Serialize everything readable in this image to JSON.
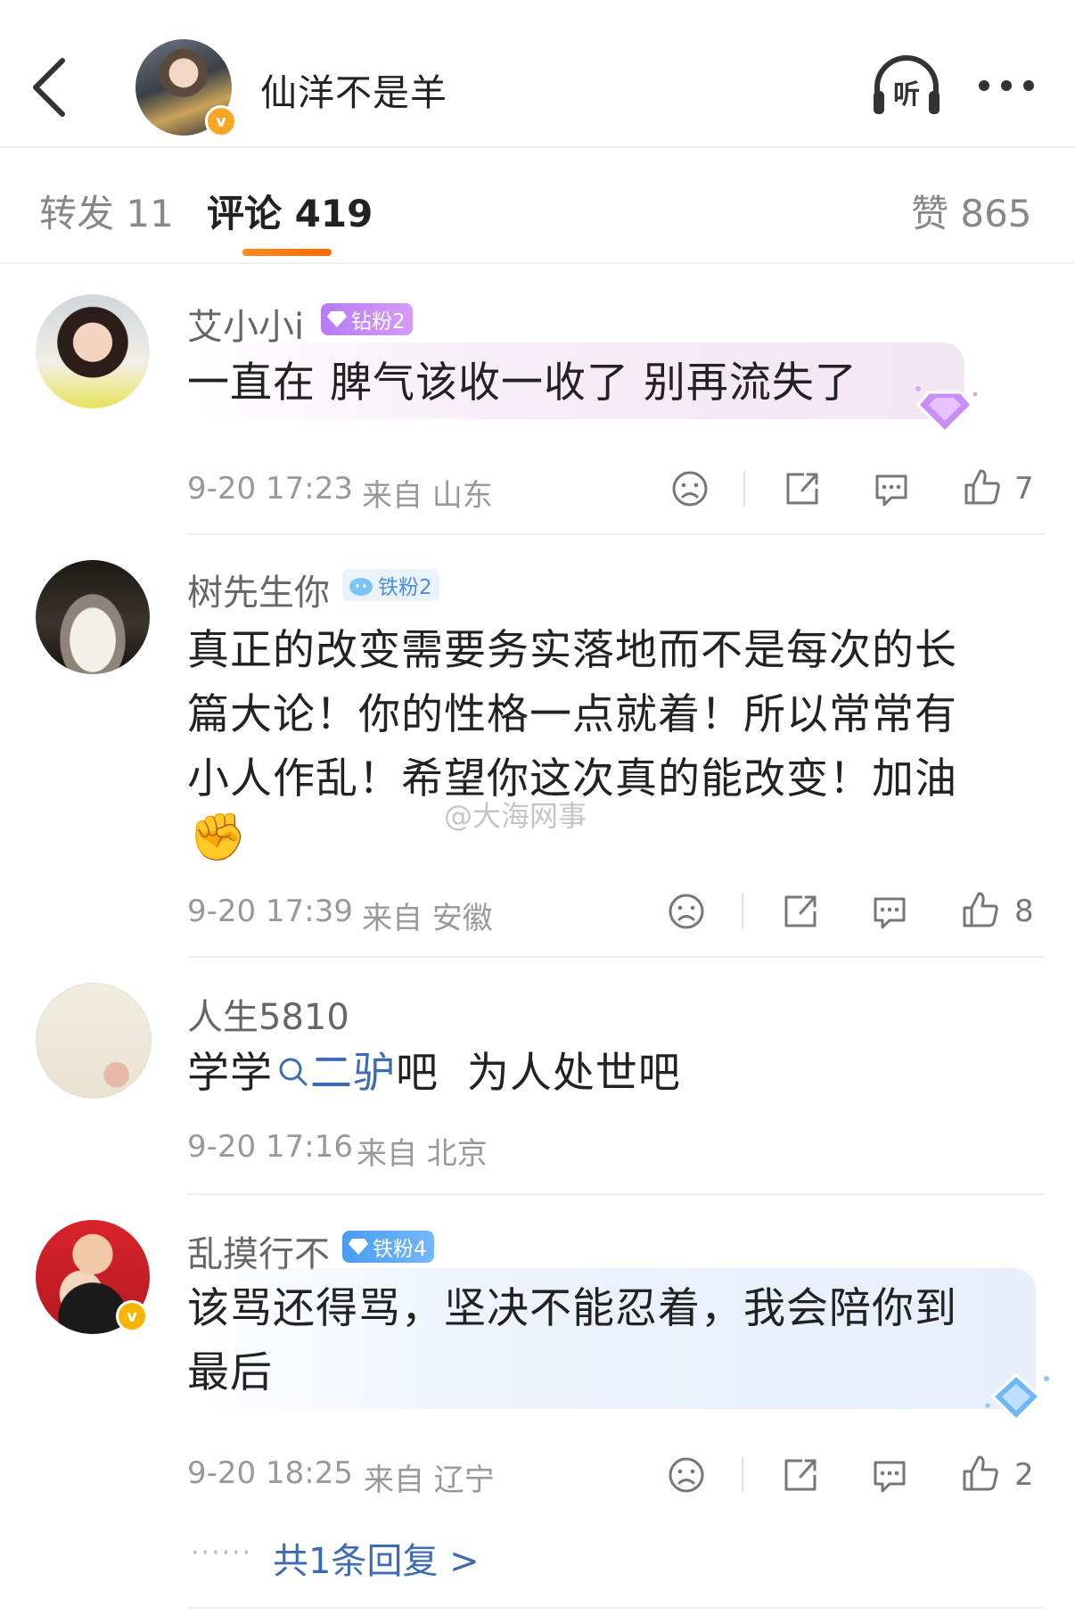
{
  "header": {
    "title": "仙洋不是羊"
  },
  "tabs": [
    {
      "label": "转发 11"
    },
    {
      "label": "评论 419"
    },
    {
      "label": "赞 865"
    }
  ],
  "comments": [
    {
      "user": "艾小小i",
      "badge": "钻粉2",
      "text": "一直在 脾气该收一收了 别再流失了",
      "time": "9-20 17:23",
      "source": "来自 山东",
      "likes": "7"
    },
    {
      "user": "树先生你",
      "badge": "铁粉2",
      "text_lines": [
        "真正的改变需要务实落地而不是每次的长",
        "篇大论！你的性格一点就着！所以常常有",
        "小人作乱！希望你这次真的能改变！加油"
      ],
      "emoji": "✊",
      "time": "9-20 17:39",
      "source": "来自 安徽",
      "likes": "8"
    },
    {
      "user": "人生5810",
      "text_before": "学学",
      "search_keyword": "二驴",
      "text_after": "吧  为人处世吧",
      "time": "9-20 17:16",
      "source": "来自 北京"
    },
    {
      "user": "乱摸行不",
      "badge": "铁粉4",
      "text_lines": [
        "该骂还得骂，坚决不能忍着，我会陪你到",
        "最后"
      ],
      "time": "9-20 18:25",
      "source": "来自 辽宁",
      "likes": "2",
      "reply_link": "共1条回复 >"
    }
  ],
  "watermark": "@大海网事",
  "colors": {
    "accent": "#ff7a00",
    "link": "#3d6cb5",
    "verified": "#f5a623"
  }
}
